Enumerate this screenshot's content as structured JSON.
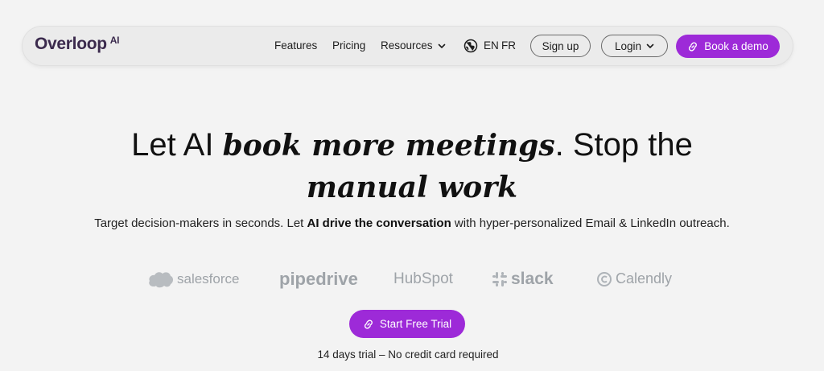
{
  "nav": {
    "logo": "Overloop",
    "logo_suffix": "AI",
    "links": [
      "Features",
      "Pricing",
      "Resources"
    ],
    "languages": [
      "EN",
      "FR"
    ],
    "signup": "Sign up",
    "login": "Login",
    "book_demo": "Book a demo"
  },
  "hero": {
    "title_1": "Let AI ",
    "title_em_1": "book more meetings",
    "title_2": ". Stop the",
    "title_em_2": "manual work",
    "subtitle_1": "Target decision-makers in seconds. Let ",
    "subtitle_bold": "AI drive the conversation",
    "subtitle_2": " with hyper-personalized Email & LinkedIn outreach."
  },
  "integrations": [
    "salesforce",
    "pipedrive",
    "HubSpot",
    "slack",
    "Calendly"
  ],
  "cta": {
    "label": "Start Free Trial",
    "note": "14 days trial – No credit card required"
  },
  "colors": {
    "accent": "#9d2ad8",
    "background": "#f3f3f3",
    "logo": "#3b2a4d",
    "brand_grey": "#9ea3a8"
  },
  "icons": {
    "link": "link-icon",
    "globe": "globe-icon",
    "chevron": "chevron-down-icon"
  }
}
